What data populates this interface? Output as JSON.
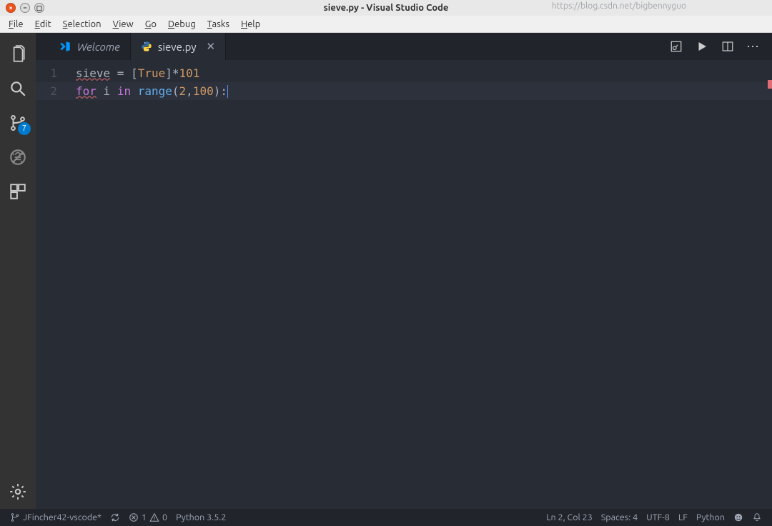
{
  "window": {
    "title": "sieve.py - Visual Studio Code"
  },
  "menu": {
    "file": "File",
    "edit": "Edit",
    "selection": "Selection",
    "view": "View",
    "go": "Go",
    "debug": "Debug",
    "tasks": "Tasks",
    "help": "Help"
  },
  "activity": {
    "scm_badge": "7"
  },
  "tabs": {
    "welcome": "Welcome",
    "sieve": "sieve.py"
  },
  "editor": {
    "lines": {
      "l1": {
        "num": "1",
        "a": "sieve",
        "eq": " = ",
        "lb": "[",
        "tr": "True",
        "rb": "]",
        "star": "*",
        "n101": "101"
      },
      "l2": {
        "num": "2",
        "for": "for",
        "sp1": " i ",
        "in": "in",
        "sp2": " ",
        "range": "range",
        "lp": "(",
        "n2": "2",
        "comma": ",",
        "n100": "100",
        "rp": ")",
        "colon": ":"
      }
    }
  },
  "status": {
    "branch": "JFincher42-vscode*",
    "err_count": "1",
    "warn_count": "0",
    "python": "Python 3.5.2",
    "cursor": "Ln 2, Col 23",
    "spaces": "Spaces: 4",
    "encoding": "UTF-8",
    "eol": "LF",
    "lang": "Python",
    "watermark": "https://blog.csdn.net/bigbennyguo"
  }
}
